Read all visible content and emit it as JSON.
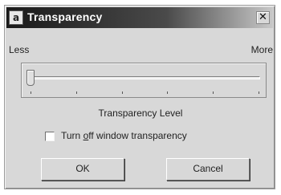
{
  "window": {
    "title": "Transparency",
    "icon_letter": "a",
    "close_glyph": "✕"
  },
  "slider": {
    "min_label": "Less",
    "max_label": "More",
    "caption": "Transparency Level",
    "value_fraction": 0.0,
    "tick_count": 6
  },
  "checkbox": {
    "label_pre": "Turn ",
    "label_mnemonic": "o",
    "label_mid": "ff",
    "label_post": " window transparency",
    "checked": false
  },
  "buttons": {
    "ok_label": "OK",
    "cancel_label": "Cancel"
  }
}
